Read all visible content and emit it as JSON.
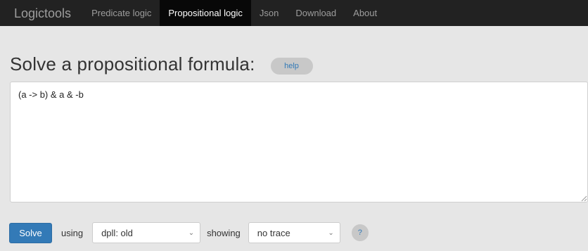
{
  "navbar": {
    "brand": "Logictools",
    "items": [
      {
        "label": "Predicate logic",
        "active": false
      },
      {
        "label": "Propositional logic",
        "active": true
      },
      {
        "label": "Json",
        "active": false
      },
      {
        "label": "Download",
        "active": false
      },
      {
        "label": "About",
        "active": false
      }
    ]
  },
  "main": {
    "title": "Solve a propositional formula:",
    "help_label": "help",
    "formula_value": "(a -> b) & a & -b"
  },
  "controls": {
    "solve_label": "Solve",
    "using_label": "using",
    "solver_selected": "dpll: old",
    "showing_label": "showing",
    "trace_selected": "no trace",
    "question_label": "?"
  },
  "colors": {
    "navbar_bg": "#222222",
    "nav_active_bg": "#080808",
    "page_bg": "#e6e6e6",
    "primary": "#337ab7"
  }
}
